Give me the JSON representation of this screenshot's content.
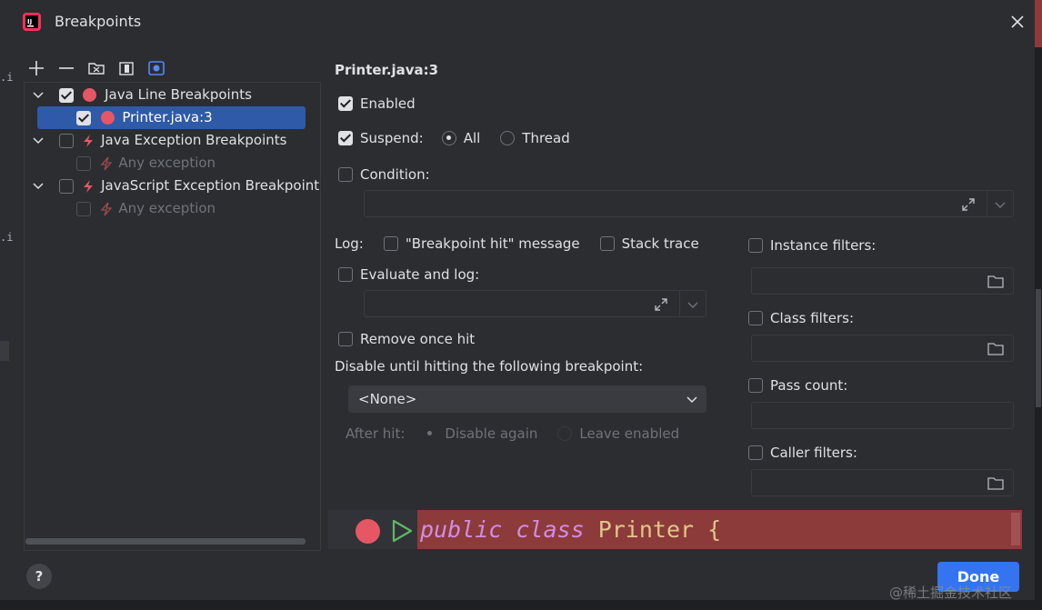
{
  "window": {
    "title": "Breakpoints"
  },
  "left_edge_fragments": [
    ".i",
    ".i"
  ],
  "toolbar": {
    "add_icon": "plus-icon",
    "remove_icon": "minus-icon",
    "group_by_file_icon": "folder-icon",
    "group_by_class_icon": "class-icon",
    "group_by_package_icon": "package-icon"
  },
  "tree": {
    "items": [
      {
        "label": "Java Line Breakpoints",
        "checked": true,
        "icon": "red-dot"
      },
      {
        "label": "Printer.java:3",
        "checked": true,
        "icon": "red-dot",
        "selected": true
      },
      {
        "label": "Java Exception Breakpoints",
        "checked": false,
        "icon": "bolt"
      },
      {
        "label": "Any exception",
        "checked": false,
        "icon": "bolt",
        "dim": true
      },
      {
        "label": "JavaScript Exception Breakpoint",
        "checked": false,
        "icon": "bolt"
      },
      {
        "label": "Any exception",
        "checked": false,
        "icon": "bolt",
        "dim": true
      }
    ]
  },
  "details": {
    "title": "Printer.java:3",
    "enabled_label": "Enabled",
    "suspend_label": "Suspend:",
    "suspend_all_label": "All",
    "suspend_thread_label": "Thread",
    "condition_label": "Condition:",
    "log_label": "Log:",
    "log_message_label": "\"Breakpoint hit\" message",
    "stack_trace_label": "Stack trace",
    "evaluate_label": "Evaluate and log:",
    "remove_once_hit_label": "Remove once hit",
    "disable_until_label": "Disable until hitting the following breakpoint:",
    "disable_until_value": "<None>",
    "after_hit_label": "After hit:",
    "disable_again_label": "Disable again",
    "leave_enabled_label": "Leave enabled",
    "instance_filters_label": "Instance filters:",
    "class_filters_label": "Class filters:",
    "pass_count_label": "Pass count:",
    "caller_filters_label": "Caller filters:"
  },
  "code_preview": {
    "keyword1": "public",
    "keyword2": "class",
    "name": "Printer {"
  },
  "footer": {
    "help_label": "?",
    "done_label": "Done",
    "watermark": "@稀土掘金技术社区"
  },
  "colors": {
    "background": "#2b2d30",
    "selection": "#2e5aa8",
    "breakpoint_red": "#e55765",
    "accent_blue": "#3574f0",
    "code_highlight": "#8d3a3a"
  }
}
